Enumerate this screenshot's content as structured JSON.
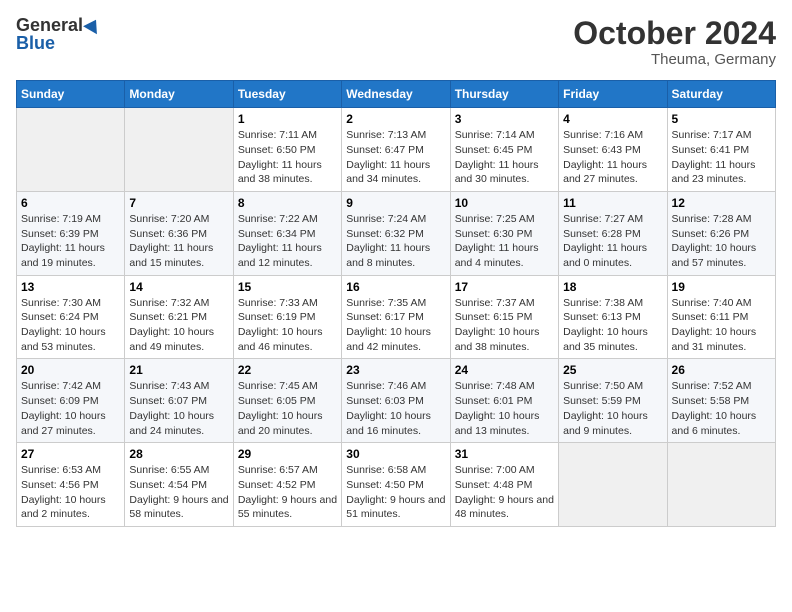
{
  "header": {
    "logo_general": "General",
    "logo_blue": "Blue",
    "month": "October 2024",
    "location": "Theuma, Germany"
  },
  "weekdays": [
    "Sunday",
    "Monday",
    "Tuesday",
    "Wednesday",
    "Thursday",
    "Friday",
    "Saturday"
  ],
  "weeks": [
    [
      {
        "day": "",
        "info": ""
      },
      {
        "day": "",
        "info": ""
      },
      {
        "day": "1",
        "info": "Sunrise: 7:11 AM\nSunset: 6:50 PM\nDaylight: 11 hours and 38 minutes."
      },
      {
        "day": "2",
        "info": "Sunrise: 7:13 AM\nSunset: 6:47 PM\nDaylight: 11 hours and 34 minutes."
      },
      {
        "day": "3",
        "info": "Sunrise: 7:14 AM\nSunset: 6:45 PM\nDaylight: 11 hours and 30 minutes."
      },
      {
        "day": "4",
        "info": "Sunrise: 7:16 AM\nSunset: 6:43 PM\nDaylight: 11 hours and 27 minutes."
      },
      {
        "day": "5",
        "info": "Sunrise: 7:17 AM\nSunset: 6:41 PM\nDaylight: 11 hours and 23 minutes."
      }
    ],
    [
      {
        "day": "6",
        "info": "Sunrise: 7:19 AM\nSunset: 6:39 PM\nDaylight: 11 hours and 19 minutes."
      },
      {
        "day": "7",
        "info": "Sunrise: 7:20 AM\nSunset: 6:36 PM\nDaylight: 11 hours and 15 minutes."
      },
      {
        "day": "8",
        "info": "Sunrise: 7:22 AM\nSunset: 6:34 PM\nDaylight: 11 hours and 12 minutes."
      },
      {
        "day": "9",
        "info": "Sunrise: 7:24 AM\nSunset: 6:32 PM\nDaylight: 11 hours and 8 minutes."
      },
      {
        "day": "10",
        "info": "Sunrise: 7:25 AM\nSunset: 6:30 PM\nDaylight: 11 hours and 4 minutes."
      },
      {
        "day": "11",
        "info": "Sunrise: 7:27 AM\nSunset: 6:28 PM\nDaylight: 11 hours and 0 minutes."
      },
      {
        "day": "12",
        "info": "Sunrise: 7:28 AM\nSunset: 6:26 PM\nDaylight: 10 hours and 57 minutes."
      }
    ],
    [
      {
        "day": "13",
        "info": "Sunrise: 7:30 AM\nSunset: 6:24 PM\nDaylight: 10 hours and 53 minutes."
      },
      {
        "day": "14",
        "info": "Sunrise: 7:32 AM\nSunset: 6:21 PM\nDaylight: 10 hours and 49 minutes."
      },
      {
        "day": "15",
        "info": "Sunrise: 7:33 AM\nSunset: 6:19 PM\nDaylight: 10 hours and 46 minutes."
      },
      {
        "day": "16",
        "info": "Sunrise: 7:35 AM\nSunset: 6:17 PM\nDaylight: 10 hours and 42 minutes."
      },
      {
        "day": "17",
        "info": "Sunrise: 7:37 AM\nSunset: 6:15 PM\nDaylight: 10 hours and 38 minutes."
      },
      {
        "day": "18",
        "info": "Sunrise: 7:38 AM\nSunset: 6:13 PM\nDaylight: 10 hours and 35 minutes."
      },
      {
        "day": "19",
        "info": "Sunrise: 7:40 AM\nSunset: 6:11 PM\nDaylight: 10 hours and 31 minutes."
      }
    ],
    [
      {
        "day": "20",
        "info": "Sunrise: 7:42 AM\nSunset: 6:09 PM\nDaylight: 10 hours and 27 minutes."
      },
      {
        "day": "21",
        "info": "Sunrise: 7:43 AM\nSunset: 6:07 PM\nDaylight: 10 hours and 24 minutes."
      },
      {
        "day": "22",
        "info": "Sunrise: 7:45 AM\nSunset: 6:05 PM\nDaylight: 10 hours and 20 minutes."
      },
      {
        "day": "23",
        "info": "Sunrise: 7:46 AM\nSunset: 6:03 PM\nDaylight: 10 hours and 16 minutes."
      },
      {
        "day": "24",
        "info": "Sunrise: 7:48 AM\nSunset: 6:01 PM\nDaylight: 10 hours and 13 minutes."
      },
      {
        "day": "25",
        "info": "Sunrise: 7:50 AM\nSunset: 5:59 PM\nDaylight: 10 hours and 9 minutes."
      },
      {
        "day": "26",
        "info": "Sunrise: 7:52 AM\nSunset: 5:58 PM\nDaylight: 10 hours and 6 minutes."
      }
    ],
    [
      {
        "day": "27",
        "info": "Sunrise: 6:53 AM\nSunset: 4:56 PM\nDaylight: 10 hours and 2 minutes."
      },
      {
        "day": "28",
        "info": "Sunrise: 6:55 AM\nSunset: 4:54 PM\nDaylight: 9 hours and 58 minutes."
      },
      {
        "day": "29",
        "info": "Sunrise: 6:57 AM\nSunset: 4:52 PM\nDaylight: 9 hours and 55 minutes."
      },
      {
        "day": "30",
        "info": "Sunrise: 6:58 AM\nSunset: 4:50 PM\nDaylight: 9 hours and 51 minutes."
      },
      {
        "day": "31",
        "info": "Sunrise: 7:00 AM\nSunset: 4:48 PM\nDaylight: 9 hours and 48 minutes."
      },
      {
        "day": "",
        "info": ""
      },
      {
        "day": "",
        "info": ""
      }
    ]
  ]
}
